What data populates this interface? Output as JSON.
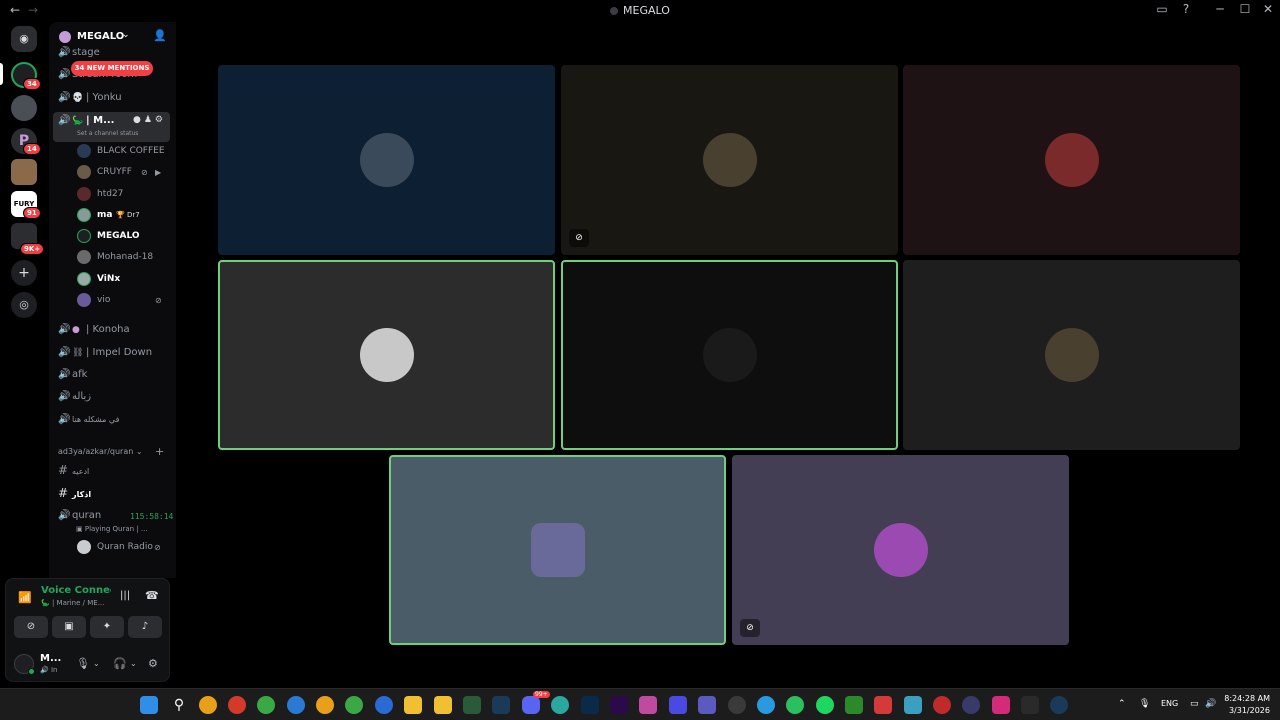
{
  "window": {
    "title": "MEGALO",
    "nav_back": "←",
    "nav_forward": "→",
    "controls": [
      "▭",
      "?",
      "─",
      "☐",
      "✕"
    ]
  },
  "rail": {
    "badges": [
      "34",
      "14",
      "91",
      "9K+"
    ]
  },
  "server": {
    "name": "MEGALO",
    "new_mentions": "34 NEW MENTIONS"
  },
  "channels": {
    "stage": "stage",
    "stream_room": "Stream room",
    "yonku": "| Yonku",
    "active_name": "| M...",
    "active_status": "Set a channel status",
    "konoha": "| Konoha",
    "impel": "| Impel Down",
    "afk": "afk",
    "zbala": "زباله",
    "problem": "في مشكله هنا",
    "category": "ad3ya/azkar/quran",
    "ad3ya": "ادعيه",
    "azkar": "اذكار",
    "quran": "quran",
    "quran_timer": "115:58:14",
    "quran_activity": "Playing Quran | ..."
  },
  "voice_users": [
    {
      "name": "BLACK COFFEE",
      "bold": false,
      "color": "#2a3a55"
    },
    {
      "name": "CRUYFF",
      "bold": false,
      "color": "#6a5a4a"
    },
    {
      "name": "htd27",
      "bold": false,
      "color": "#5a2a2a"
    },
    {
      "name": "ma",
      "bold": true,
      "color": "#8a9a9a",
      "tag": "🏆 Dr7"
    },
    {
      "name": "MEGALO",
      "bold": true,
      "color": "#1e1f22"
    },
    {
      "name": "Mohanad-18",
      "bold": false,
      "color": "#6a6a6a"
    },
    {
      "name": "ViNx",
      "bold": true,
      "color": "#9aa8a8"
    },
    {
      "name": "vio",
      "bold": false,
      "color": "#6a5a9a"
    }
  ],
  "quran_radio": "Quran Radio",
  "voice_panel": {
    "title": "Voice Connected",
    "subtitle": "🦕 | Marine / ME...",
    "user_name": "M...",
    "user_status": "In"
  },
  "tiles": [
    {
      "bg": "#0c1f33",
      "avatar": "#3a4a5a",
      "speaking": false,
      "muted": false
    },
    {
      "bg": "#191712",
      "avatar": "#4a4030",
      "speaking": false,
      "muted": true
    },
    {
      "bg": "#1e1214",
      "avatar": "#7a2a2a",
      "speaking": false,
      "muted": false
    },
    {
      "bg": "#2c2c2c",
      "avatar": "#c8c8c8",
      "speaking": true,
      "muted": false
    },
    {
      "bg": "#0e0e0e",
      "avatar": "#1a1a1a",
      "speaking": true,
      "muted": false
    },
    {
      "bg": "#1e1e1e",
      "avatar": "#4a4030",
      "speaking": false,
      "muted": false
    },
    {
      "bg": "#4a5c68",
      "avatar": "#6a6a9a",
      "speaking": true,
      "muted": false
    },
    {
      "bg": "#443e54",
      "avatar": "#9a4ab0",
      "speaking": false,
      "muted": true
    }
  ],
  "taskbar": {
    "lang": "ENG",
    "time": "8:24:28 AM",
    "date": "3/31/2026",
    "discord_badge": "99+"
  }
}
